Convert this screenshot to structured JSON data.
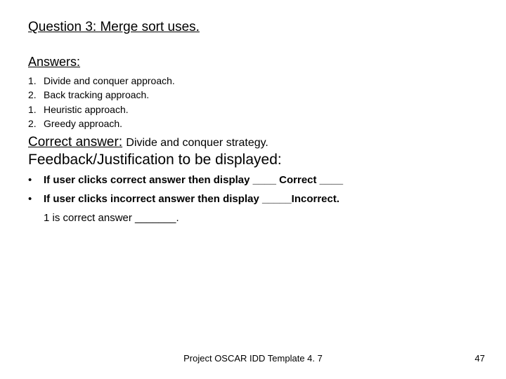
{
  "question": "Question 3: Merge sort uses.",
  "answers_heading": "Answers:",
  "answers": [
    {
      "num": "1.",
      "text": "Divide and conquer approach."
    },
    {
      "num": "2.",
      "text": " Back tracking approach."
    },
    {
      "num": "1.",
      "text": " Heuristic approach."
    },
    {
      "num": "2.",
      "text": " Greedy approach."
    }
  ],
  "correct_label": "Correct answer:",
  "correct_value": "Divide and conquer strategy.",
  "feedback_heading": "Feedback/Justification to be displayed:",
  "bullets": [
    "If user clicks correct answer then display  ____ Correct ____",
    "If user clicks incorrect answer then display  _____Incorrect."
  ],
  "final_note": "1 is correct answer _______.",
  "footer_center": "Project OSCAR IDD Template 4. 7",
  "footer_right": "47"
}
